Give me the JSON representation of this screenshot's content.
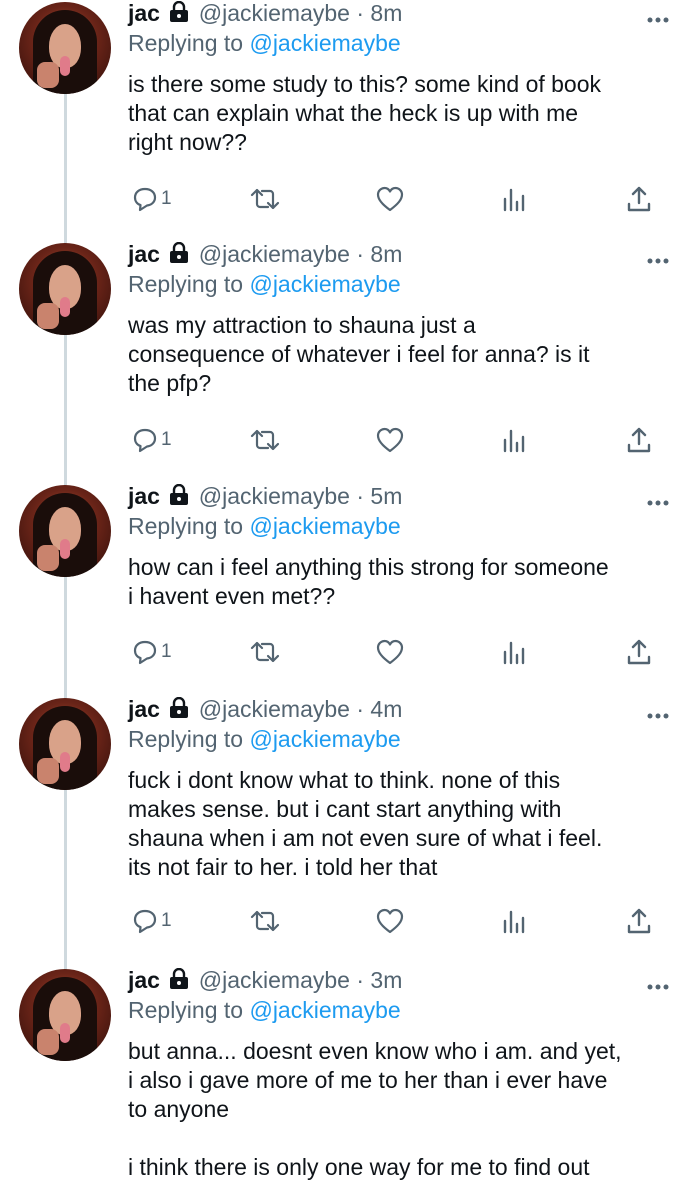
{
  "colors": {
    "link": "#1d9bf0",
    "muted": "#536471",
    "text": "#0f1419",
    "thread_line": "#cfd9de"
  },
  "icons": [
    "lock-icon",
    "more-icon",
    "reply-icon",
    "retweet-icon",
    "like-icon",
    "views-icon",
    "share-icon"
  ],
  "tweets": [
    {
      "name": "jac",
      "handle": "@jackiemaybe",
      "dot": "·",
      "time": "8m",
      "replying_prefix": "Replying to ",
      "replying_to": "@jackiemaybe",
      "text": "is there some study to this? some kind of book\nthat can explain what the heck is up with me\nright now??",
      "reply_count": "1"
    },
    {
      "name": "jac",
      "handle": "@jackiemaybe",
      "dot": "·",
      "time": "8m",
      "replying_prefix": "Replying to ",
      "replying_to": "@jackiemaybe",
      "text": "was my attraction to shauna just a\nconsequence of whatever i feel for anna? is it\nthe pfp?",
      "reply_count": "1"
    },
    {
      "name": "jac",
      "handle": "@jackiemaybe",
      "dot": "·",
      "time": "5m",
      "replying_prefix": "Replying to ",
      "replying_to": "@jackiemaybe",
      "text": "how can i feel anything this strong for someone\ni havent even met??",
      "reply_count": "1"
    },
    {
      "name": "jac",
      "handle": "@jackiemaybe",
      "dot": "·",
      "time": "4m",
      "replying_prefix": "Replying to ",
      "replying_to": "@jackiemaybe",
      "text": "fuck i dont know what to think. none of this\nmakes sense. but i cant start anything with\nshauna when i am not even sure of what i feel.\nits not fair to her. i told her that",
      "reply_count": "1"
    },
    {
      "name": "jac",
      "handle": "@jackiemaybe",
      "dot": "·",
      "time": "3m",
      "replying_prefix": "Replying to ",
      "replying_to": "@jackiemaybe",
      "text": "but anna... doesnt even know who i am. and yet,\ni also i gave more of me to her than i ever have\nto anyone\n\ni think there is only one way for me to find out",
      "reply_count": ""
    }
  ]
}
